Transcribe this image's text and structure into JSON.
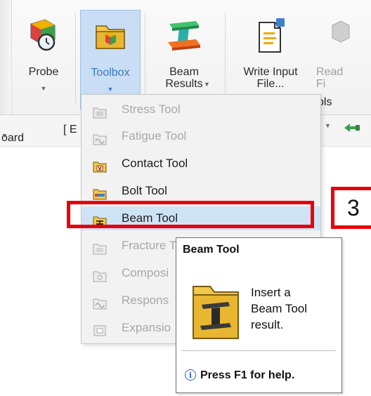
{
  "ribbon": {
    "probe": {
      "label": "Probe"
    },
    "toolbox": {
      "label": "Toolbox"
    },
    "beam_results": {
      "label": "Beam\nResults"
    },
    "write_input": {
      "label": "Write Input\nFile..."
    },
    "read": {
      "label": "Read\nFi"
    },
    "group_label": "ols"
  },
  "toolbar_row": {
    "board_label": "oard",
    "bracket_label": "[ E"
  },
  "menu": {
    "items": [
      {
        "label": "Stress Tool",
        "enabled": false
      },
      {
        "label": "Fatigue Tool",
        "enabled": false
      },
      {
        "label": "Contact Tool",
        "enabled": true
      },
      {
        "label": "Bolt Tool",
        "enabled": true
      },
      {
        "label": "Beam Tool",
        "enabled": true,
        "highlighted": true
      },
      {
        "label": "Fracture Tool",
        "enabled": false
      },
      {
        "label": "Composi",
        "enabled": false
      },
      {
        "label": "Respons",
        "enabled": false
      },
      {
        "label": "Expansio",
        "enabled": false
      }
    ]
  },
  "annotation": {
    "step_number": "3",
    "color": "#e8000b"
  },
  "tooltip": {
    "title": "Beam Tool",
    "description_lines": [
      "Insert a",
      "Beam Tool",
      "result."
    ],
    "help": "Press F1 for help."
  },
  "colors": {
    "highlight": "#cfe3f6",
    "toolbox_active": "#c9def5"
  }
}
